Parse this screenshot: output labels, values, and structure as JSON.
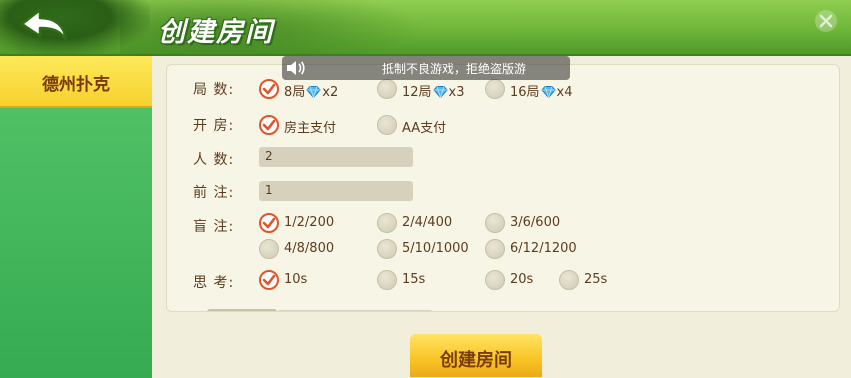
{
  "header": {
    "title": "创建房间"
  },
  "sidebar": {
    "tabs": [
      {
        "label": "德州扑克",
        "active": true
      }
    ]
  },
  "notice": {
    "text": "抵制不良游戏，拒绝盗版游"
  },
  "rules": {
    "rounds": {
      "label": "局  数:",
      "options": [
        {
          "label": "8局",
          "mult": "x2",
          "selected": true
        },
        {
          "label": "12局",
          "mult": "x3",
          "selected": false
        },
        {
          "label": "16局",
          "mult": "x4",
          "selected": false
        }
      ]
    },
    "payment": {
      "label": "开  房:",
      "options": [
        {
          "label": "房主支付",
          "selected": true
        },
        {
          "label": "AA支付",
          "selected": false
        }
      ]
    },
    "players": {
      "label": "人  数:",
      "value": "2"
    },
    "ante": {
      "label": "前  注:",
      "value": "1"
    },
    "blinds": {
      "label": "盲  注:",
      "options": [
        {
          "label": "1/2/200",
          "selected": true
        },
        {
          "label": "2/4/400",
          "selected": false
        },
        {
          "label": "3/6/600",
          "selected": false
        },
        {
          "label": "4/8/800",
          "selected": false
        },
        {
          "label": "5/10/1000",
          "selected": false
        },
        {
          "label": "6/12/1200",
          "selected": false
        }
      ]
    },
    "think": {
      "label": "思  考:",
      "options": [
        {
          "label": "10s",
          "selected": true
        },
        {
          "label": "15s",
          "selected": false
        },
        {
          "label": "20s",
          "selected": false
        },
        {
          "label": "25s",
          "selected": false
        }
      ]
    }
  },
  "footer": {
    "create_label": "创建房间"
  },
  "colors": {
    "accent": "#e2542a",
    "header_green": "#6fb63a",
    "tab_yellow": "#f6d12e",
    "text_brown": "#5d3c1e"
  },
  "icons": {
    "back": "back-arrow-icon",
    "sound": "speaker-icon",
    "gem": "diamond-icon",
    "check": "check-icon"
  }
}
